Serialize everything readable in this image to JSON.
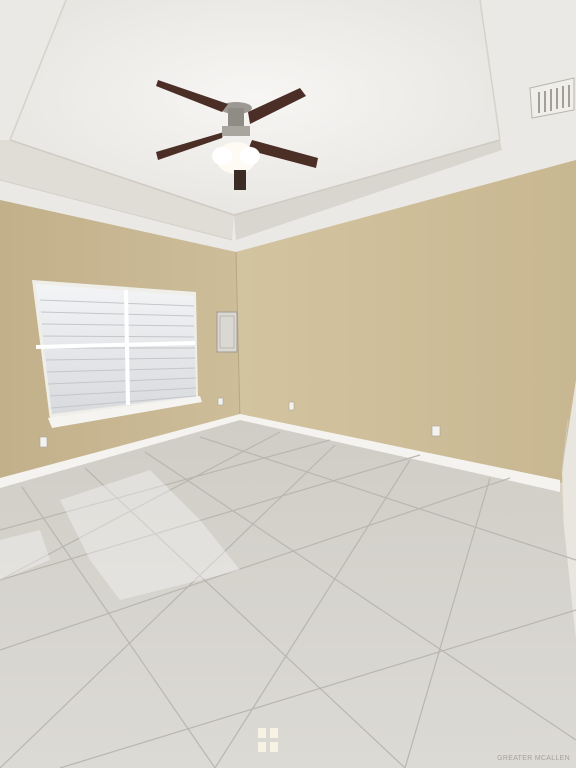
{
  "photo": {
    "watermark": "GREATER MCALLEN",
    "colors": {
      "wall_left": "#c9b995",
      "wall_right": "#cdbd97",
      "ceiling": "#f2f1ee",
      "floor": "#d8d6d1",
      "baseboard": "#f4f3f0",
      "fan_blade": "#4b2e26"
    },
    "objects": [
      "ceiling-fan",
      "window-with-blinds",
      "electrical-panel",
      "air-vent",
      "tile-floor",
      "wall-outlets"
    ]
  }
}
